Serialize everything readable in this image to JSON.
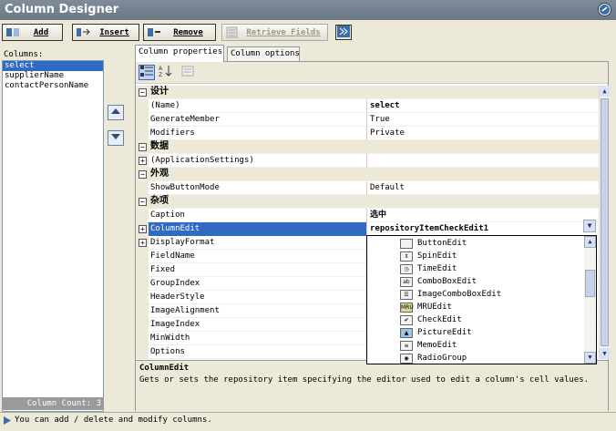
{
  "window": {
    "title": "Column Designer"
  },
  "toolbar": {
    "add_label": "Add",
    "insert_label": "Insert",
    "remove_label": "Remove",
    "retrieve_label": "Retrieve Fields"
  },
  "columns_panel": {
    "label": "Columns:",
    "items": [
      "select",
      "supplierName",
      "contactPersonName"
    ],
    "selected": "select",
    "count_text": "Column Count: 3"
  },
  "tabs": [
    "Column properties",
    "Column options"
  ],
  "properties": {
    "categories": {
      "design": "设计",
      "data": "数据",
      "appearance": "外观",
      "misc": "杂项"
    },
    "rows": {
      "name": {
        "name": "(Name)",
        "value": "select"
      },
      "generate_member": {
        "name": "GenerateMember",
        "value": "True"
      },
      "modifiers": {
        "name": "Modifiers",
        "value": "Private"
      },
      "app_settings": {
        "name": "(ApplicationSettings)",
        "value": ""
      },
      "show_button_mode": {
        "name": "ShowButtonMode",
        "value": "Default"
      },
      "caption": {
        "name": "Caption",
        "value": "选中"
      },
      "column_edit": {
        "name": "ColumnEdit",
        "value": "repositoryItemCheckEdit1"
      },
      "display_format": {
        "name": "DisplayFormat"
      },
      "field_name": {
        "name": "FieldName"
      },
      "fixed": {
        "name": "Fixed"
      },
      "group_index": {
        "name": "GroupIndex"
      },
      "header_style": {
        "name": "HeaderStyle"
      },
      "image_alignment": {
        "name": "ImageAlignment"
      },
      "image_index": {
        "name": "ImageIndex"
      },
      "min_width": {
        "name": "MinWidth"
      },
      "options": {
        "name": "Options"
      }
    }
  },
  "editor_dropdown": {
    "items": [
      "ButtonEdit",
      "SpinEdit",
      "TimeEdit",
      "ComboBoxEdit",
      "ImageComboBoxEdit",
      "MRUEdit",
      "CheckEdit",
      "PictureEdit",
      "MemoEdit",
      "RadioGroup"
    ]
  },
  "description": {
    "title": "ColumnEdit",
    "text": "Gets or sets the repository item specifying the editor used to edit a column's cell values."
  },
  "status": {
    "text": "You can add / delete and modify columns."
  },
  "colors": {
    "selection": "#316ac5",
    "title_bar": "#7f8c99",
    "background": "#ece9d8"
  }
}
